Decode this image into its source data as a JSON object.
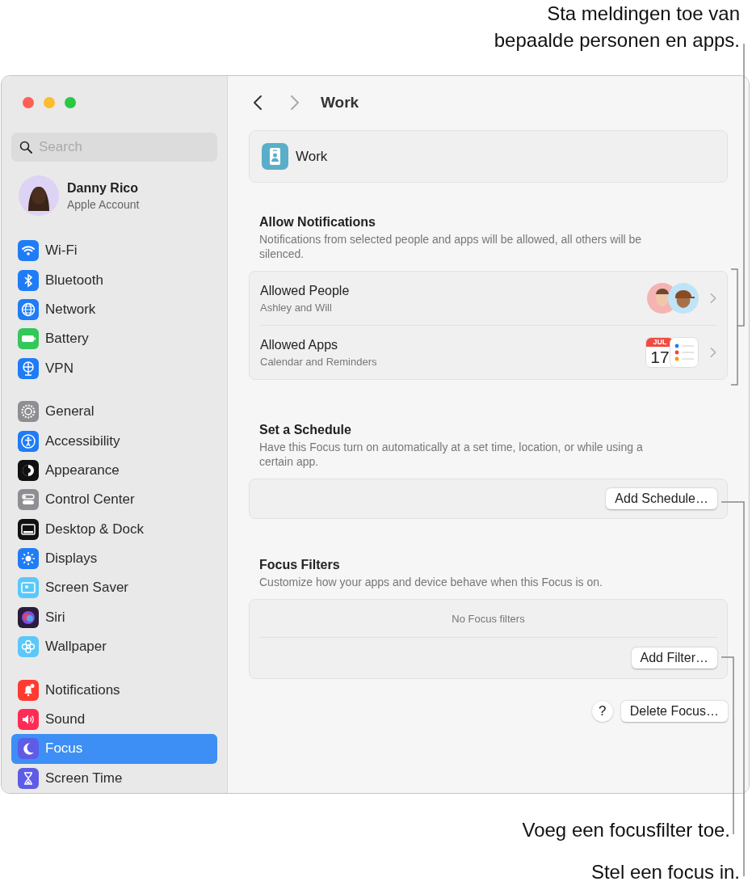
{
  "callouts": {
    "top": "Sta meldingen toe van\nbepaalde personen en apps.",
    "filter": "Voeg een focusfilter toe.",
    "focus": "Stel een focus in."
  },
  "sidebar": {
    "search": {
      "placeholder": "Search"
    },
    "account": {
      "name": "Danny Rico",
      "subtitle": "Apple Account"
    },
    "groups": [
      {
        "items": [
          {
            "label": "Wi-Fi",
            "selected": false
          },
          {
            "label": "Bluetooth",
            "selected": false
          },
          {
            "label": "Network",
            "selected": false
          },
          {
            "label": "Battery",
            "selected": false
          },
          {
            "label": "VPN",
            "selected": false
          }
        ]
      },
      {
        "items": [
          {
            "label": "General",
            "selected": false
          },
          {
            "label": "Accessibility",
            "selected": false
          },
          {
            "label": "Appearance",
            "selected": false
          },
          {
            "label": "Control Center",
            "selected": false
          },
          {
            "label": "Desktop & Dock",
            "selected": false
          },
          {
            "label": "Displays",
            "selected": false
          },
          {
            "label": "Screen Saver",
            "selected": false
          },
          {
            "label": "Siri",
            "selected": false
          },
          {
            "label": "Wallpaper",
            "selected": false
          }
        ]
      },
      {
        "items": [
          {
            "label": "Notifications",
            "selected": false
          },
          {
            "label": "Sound",
            "selected": false
          },
          {
            "label": "Focus",
            "selected": true
          },
          {
            "label": "Screen Time",
            "selected": false
          }
        ]
      }
    ]
  },
  "header": {
    "title": "Work",
    "nav": [
      {
        "kind": "back",
        "disabled": false
      },
      {
        "kind": "forward",
        "disabled": true
      }
    ]
  },
  "focus_card": {
    "name": "Work"
  },
  "allow_notifications": {
    "title": "Allow Notifications",
    "description": "Notifications from selected people and apps will be allowed, all others will be silenced.",
    "rows": [
      {
        "kind": "people",
        "title": "Allowed People",
        "subtitle": "Ashley and Will"
      },
      {
        "kind": "apps",
        "title": "Allowed Apps",
        "subtitle": "Calendar and Reminders",
        "calendar_month": "JUL",
        "calendar_day": "17"
      }
    ]
  },
  "schedule": {
    "title": "Set a Schedule",
    "description": "Have this Focus turn on automatically at a set time, location, or while using a certain app.",
    "button": "Add Schedule…"
  },
  "filters": {
    "title": "Focus Filters",
    "description": "Customize how your apps and device behave when this Focus is on.",
    "empty": "No Focus filters",
    "button": "Add Filter…"
  },
  "footer": {
    "help": "?",
    "button": "Delete Focus…"
  }
}
